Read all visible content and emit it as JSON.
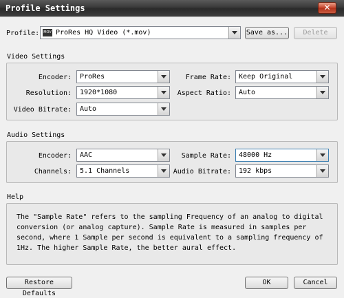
{
  "window": {
    "title": "Profile Settings",
    "close_glyph": "✕"
  },
  "profile": {
    "label": "Profile:",
    "icon_text": "MOV",
    "value": "ProRes HQ Video (*.mov)",
    "save_as_label": "Save as...",
    "delete_label": "Delete"
  },
  "video": {
    "section_title": "Video Settings",
    "encoder": {
      "label": "Encoder:",
      "value": "ProRes"
    },
    "resolution": {
      "label": "Resolution:",
      "value": "1920*1080"
    },
    "bitrate": {
      "label": "Video Bitrate:",
      "value": "Auto"
    },
    "frame_rate": {
      "label": "Frame Rate:",
      "value": "Keep Original"
    },
    "aspect_ratio": {
      "label": "Aspect Ratio:",
      "value": "Auto"
    }
  },
  "audio": {
    "section_title": "Audio Settings",
    "encoder": {
      "label": "Encoder:",
      "value": "AAC"
    },
    "channels": {
      "label": "Channels:",
      "value": "5.1 Channels"
    },
    "sample_rate": {
      "label": "Sample Rate:",
      "value": "48000 Hz"
    },
    "bitrate": {
      "label": "Audio Bitrate:",
      "value": "192 kbps"
    }
  },
  "help": {
    "section_title": "Help",
    "text": "The \"Sample Rate\" refers to the sampling Frequency of an analog to digital conversion (or analog capture). Sample Rate is measured in samples per second, where 1 Sample per second is equivalent to a sampling frequency of 1Hz. The higher Sample Rate, the better aural effect."
  },
  "footer": {
    "restore_label": "Restore Defaults",
    "ok_label": "OK",
    "cancel_label": "Cancel"
  }
}
